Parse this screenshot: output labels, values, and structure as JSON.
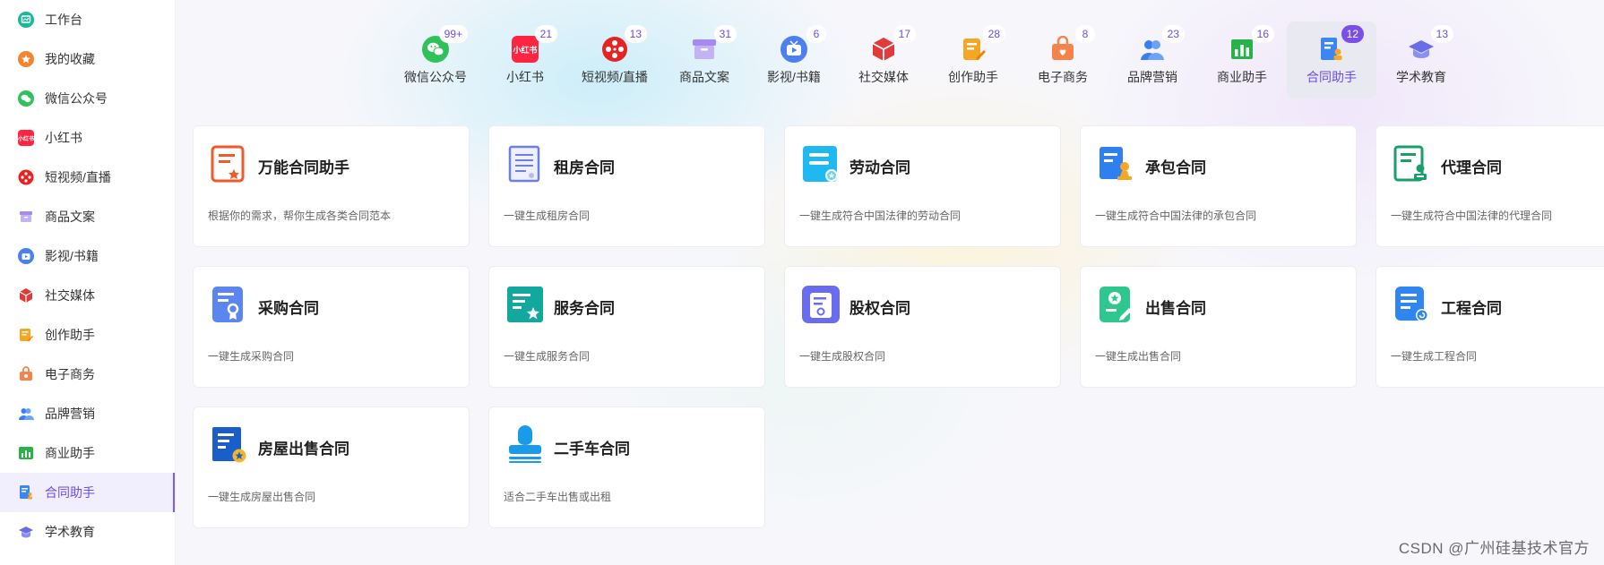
{
  "sidebar": {
    "items": [
      {
        "label": "工作台",
        "icon": "workbench-icon",
        "color": "#18b89b"
      },
      {
        "label": "我的收藏",
        "icon": "star-icon",
        "color": "#f5842d"
      },
      {
        "label": "微信公众号",
        "icon": "wechat-icon",
        "color": "#2fc25a"
      },
      {
        "label": "小红书",
        "icon": "xiaohongshu-icon",
        "color": "#ff2442"
      },
      {
        "label": "短视频/直播",
        "icon": "film-reel-icon",
        "color": "#e52323"
      },
      {
        "label": "商品文案",
        "icon": "product-box-icon",
        "color": "#a58bf0"
      },
      {
        "label": "影视/书籍",
        "icon": "tv-icon",
        "color": "#4c7ff0"
      },
      {
        "label": "社交媒体",
        "icon": "cube-icon",
        "color": "#e23a3a"
      },
      {
        "label": "创作助手",
        "icon": "pen-note-icon",
        "color": "#f5a623"
      },
      {
        "label": "电子商务",
        "icon": "shop-bag-icon",
        "color": "#f4844a"
      },
      {
        "label": "品牌营销",
        "icon": "people-icon",
        "color": "#3a7ff2"
      },
      {
        "label": "商业助手",
        "icon": "bar-chart-icon",
        "color": "#27b24a"
      },
      {
        "label": "合同助手",
        "icon": "contract-icon",
        "color": "#3a86f2",
        "active": true
      },
      {
        "label": "学术教育",
        "icon": "graduation-cap-icon",
        "color": "#6a6ce8"
      }
    ]
  },
  "categories": [
    {
      "label": "微信公众号",
      "badge": "99+",
      "icon": "wechat-icon",
      "color": "#2fc25a"
    },
    {
      "label": "小红书",
      "badge": "21",
      "icon": "xiaohongshu-icon",
      "color": "#ff2442",
      "icon_text": "小红书"
    },
    {
      "label": "短视频/直播",
      "badge": "13",
      "icon": "film-reel-icon",
      "color": "#e52323"
    },
    {
      "label": "商品文案",
      "badge": "31",
      "icon": "product-box-icon",
      "color": "#a58bf0"
    },
    {
      "label": "影视/书籍",
      "badge": "6",
      "icon": "tv-icon",
      "color": "#4c7ff0"
    },
    {
      "label": "社交媒体",
      "badge": "17",
      "icon": "cube-icon",
      "color": "#e23a3a"
    },
    {
      "label": "创作助手",
      "badge": "28",
      "icon": "pen-note-icon",
      "color": "#f5a623"
    },
    {
      "label": "电子商务",
      "badge": "8",
      "icon": "shop-bag-icon",
      "color": "#f4844a"
    },
    {
      "label": "品牌营销",
      "badge": "23",
      "icon": "people-icon",
      "color": "#3a7ff2"
    },
    {
      "label": "商业助手",
      "badge": "16",
      "icon": "bar-chart-icon",
      "color": "#27b24a"
    },
    {
      "label": "合同助手",
      "badge": "12",
      "icon": "contract-icon",
      "color": "#3a86f2",
      "active": true
    },
    {
      "label": "学术教育",
      "badge": "13",
      "icon": "graduation-cap-icon",
      "color": "#6a6ce8"
    }
  ],
  "cards": [
    {
      "title": "万能合同助手",
      "desc": "根据你的需求，帮你生成各类合同范本",
      "icon": "universal-contract-icon",
      "color": "#f25a2c"
    },
    {
      "title": "租房合同",
      "desc": "一键生成租房合同",
      "icon": "rent-contract-icon",
      "color": "#6f7fe0"
    },
    {
      "title": "劳动合同",
      "desc": "一键生成符合中国法律的劳动合同",
      "icon": "labor-contract-icon",
      "color": "#1fb8f0"
    },
    {
      "title": "承包合同",
      "desc": "一键生成符合中国法律的承包合同",
      "icon": "contracting-icon",
      "color": "#2e7ff0"
    },
    {
      "title": "代理合同",
      "desc": "一键生成符合中国法律的代理合同",
      "icon": "agency-contract-icon",
      "color": "#1a9e6a"
    },
    {
      "title": "采购合同",
      "desc": "一键生成采购合同",
      "icon": "purchase-contract-icon",
      "color": "#5b86f0"
    },
    {
      "title": "服务合同",
      "desc": "一键生成服务合同",
      "icon": "service-contract-icon",
      "color": "#13a89e"
    },
    {
      "title": "股权合同",
      "desc": "一键生成股权合同",
      "icon": "equity-contract-icon",
      "color": "#6a6cf0"
    },
    {
      "title": "出售合同",
      "desc": "一键生成出售合同",
      "icon": "sale-contract-icon",
      "color": "#2ec78f"
    },
    {
      "title": "工程合同",
      "desc": "一键生成工程合同",
      "icon": "engineering-contract-icon",
      "color": "#2f86f0"
    },
    {
      "title": "房屋出售合同",
      "desc": "一键生成房屋出售合同",
      "icon": "house-sale-contract-icon",
      "color": "#1a5fc9"
    },
    {
      "title": "二手车合同",
      "desc": "适合二手车出售或出租",
      "icon": "used-car-contract-icon",
      "color": "#1a9bea"
    }
  ],
  "watermark": "CSDN @广州硅基技术官方"
}
